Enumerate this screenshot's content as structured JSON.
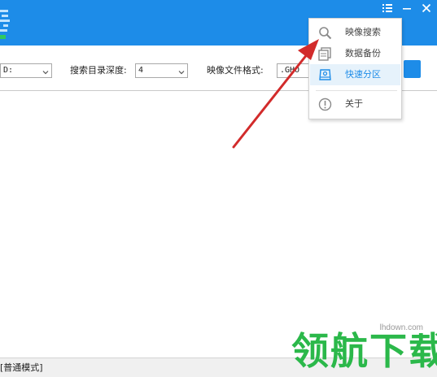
{
  "toolbar": {
    "drive": {
      "value": "D:"
    },
    "depth": {
      "label": "搜索目录深度:",
      "value": "4"
    },
    "format": {
      "label": "映像文件格式:",
      "value": ".GHO"
    }
  },
  "menu": {
    "items": [
      {
        "label": "映像搜索",
        "icon": "search-icon"
      },
      {
        "label": "数据备份",
        "icon": "copy-icon"
      },
      {
        "label": "快速分区",
        "icon": "disk-icon",
        "active": true
      },
      {
        "label": "关于",
        "icon": "info-icon"
      }
    ]
  },
  "statusbar": {
    "text": "[普通模式]"
  },
  "watermark": {
    "text": "领航下载",
    "url": "lhdown.com"
  },
  "colors": {
    "titlebar": "#1d8ce8",
    "accent": "#1d8ce8",
    "arrow": "#d22b2b",
    "watermark": "#2bb84a"
  }
}
